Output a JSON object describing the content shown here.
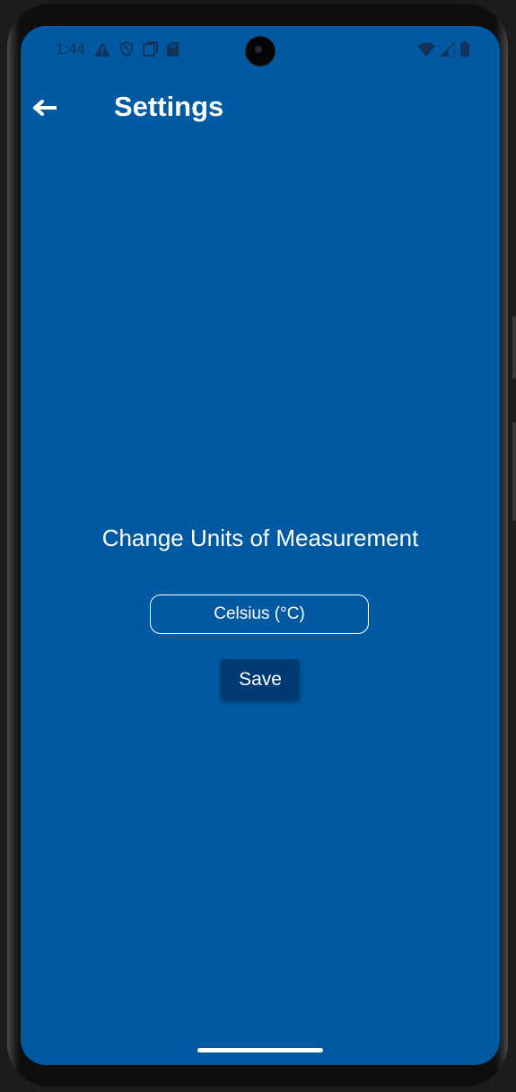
{
  "status_bar": {
    "time": "1:44",
    "left_icons": [
      "warning-icon",
      "shield-icon",
      "square-icon",
      "sd-card-icon"
    ],
    "right_icons": [
      "wifi-icon",
      "signal-icon",
      "battery-icon"
    ]
  },
  "app_bar": {
    "title": "Settings",
    "back_icon": "arrow-back-icon"
  },
  "main": {
    "heading": "Change Units of Measurement",
    "unit_select_value": "Celsius (°C)",
    "save_label": "Save"
  },
  "colors": {
    "background": "#0059a1",
    "button": "#003a73",
    "text": "#ffffff"
  }
}
